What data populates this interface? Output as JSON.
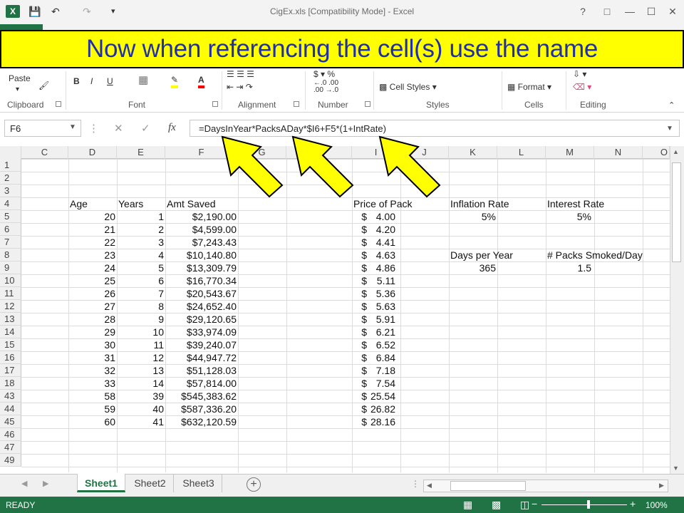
{
  "window": {
    "title": "CigEx.xls  [Compatibility Mode] - Excel",
    "app_icon_letter": "X"
  },
  "banner": {
    "text": "Now when referencing the cell(s) use the name"
  },
  "ribbon": {
    "paste_label": "Paste",
    "clipboard_label": "Clipboard",
    "font_label": "Font",
    "alignment_label": "Alignment",
    "number_label": "Number",
    "styles_label": "Styles",
    "cells_label": "Cells",
    "editing_label": "Editing",
    "cell_styles_label": "Cell Styles",
    "format_label": "Format",
    "bold_label": "B",
    "italic_label": "I",
    "underline_label": "U",
    "fx_label": "fx"
  },
  "formula_bar": {
    "name_box": "F6",
    "formula": "=DaysInYear*PacksADay*$I6+F5*(1+IntRate)"
  },
  "columns": [
    "C",
    "D",
    "E",
    "F",
    "G",
    "H",
    "I",
    "J",
    "K",
    "L",
    "M",
    "N",
    "O"
  ],
  "rows": [
    "1",
    "2",
    "3",
    "4",
    "5",
    "6",
    "7",
    "8",
    "9",
    "10",
    "11",
    "12",
    "13",
    "14",
    "15",
    "16",
    "17",
    "18",
    "43",
    "44",
    "45",
    "46",
    "47",
    "49"
  ],
  "headers": {
    "age": "Age",
    "years": "Years",
    "amt_saved": "Amt Saved",
    "price_of_pack": "Price of Pack",
    "inflation_rate": "Inflation Rate",
    "interest_rate": "Interest Rate",
    "days_per_year": "Days per Year",
    "packs_smoked": "# Packs Smoked/Day"
  },
  "params": {
    "inflation_rate": "5%",
    "interest_rate": "5%",
    "days_per_year": "365",
    "packs_per_day": "1.5"
  },
  "table": [
    {
      "age": "20",
      "years": "1",
      "amt": "$2,190.00",
      "cur": "$",
      "price": "4.00"
    },
    {
      "age": "21",
      "years": "2",
      "amt": "$4,599.00",
      "cur": "$",
      "price": "4.20"
    },
    {
      "age": "22",
      "years": "3",
      "amt": "$7,243.43",
      "cur": "$",
      "price": "4.41"
    },
    {
      "age": "23",
      "years": "4",
      "amt": "$10,140.80",
      "cur": "$",
      "price": "4.63"
    },
    {
      "age": "24",
      "years": "5",
      "amt": "$13,309.79",
      "cur": "$",
      "price": "4.86"
    },
    {
      "age": "25",
      "years": "6",
      "amt": "$16,770.34",
      "cur": "$",
      "price": "5.11"
    },
    {
      "age": "26",
      "years": "7",
      "amt": "$20,543.67",
      "cur": "$",
      "price": "5.36"
    },
    {
      "age": "27",
      "years": "8",
      "amt": "$24,652.40",
      "cur": "$",
      "price": "5.63"
    },
    {
      "age": "28",
      "years": "9",
      "amt": "$29,120.65",
      "cur": "$",
      "price": "5.91"
    },
    {
      "age": "29",
      "years": "10",
      "amt": "$33,974.09",
      "cur": "$",
      "price": "6.21"
    },
    {
      "age": "30",
      "years": "11",
      "amt": "$39,240.07",
      "cur": "$",
      "price": "6.52"
    },
    {
      "age": "31",
      "years": "12",
      "amt": "$44,947.72",
      "cur": "$",
      "price": "6.84"
    },
    {
      "age": "32",
      "years": "13",
      "amt": "$51,128.03",
      "cur": "$",
      "price": "7.18"
    },
    {
      "age": "33",
      "years": "14",
      "amt": "$57,814.00",
      "cur": "$",
      "price": "7.54"
    },
    {
      "age": "58",
      "years": "39",
      "amt": "$545,383.62",
      "cur": "$",
      "price": "25.54"
    },
    {
      "age": "59",
      "years": "40",
      "amt": "$587,336.20",
      "cur": "$",
      "price": "26.82"
    },
    {
      "age": "60",
      "years": "41",
      "amt": "$632,120.59",
      "cur": "$",
      "price": "28.16"
    }
  ],
  "sheets": [
    "Sheet1",
    "Sheet2",
    "Sheet3"
  ],
  "status": {
    "ready": "READY",
    "zoom": "100%"
  },
  "colors": {
    "excel_green": "#217346",
    "banner_yellow": "#ffff00",
    "banner_text": "#1f2fa8",
    "arrow_fill": "#ffff00"
  }
}
